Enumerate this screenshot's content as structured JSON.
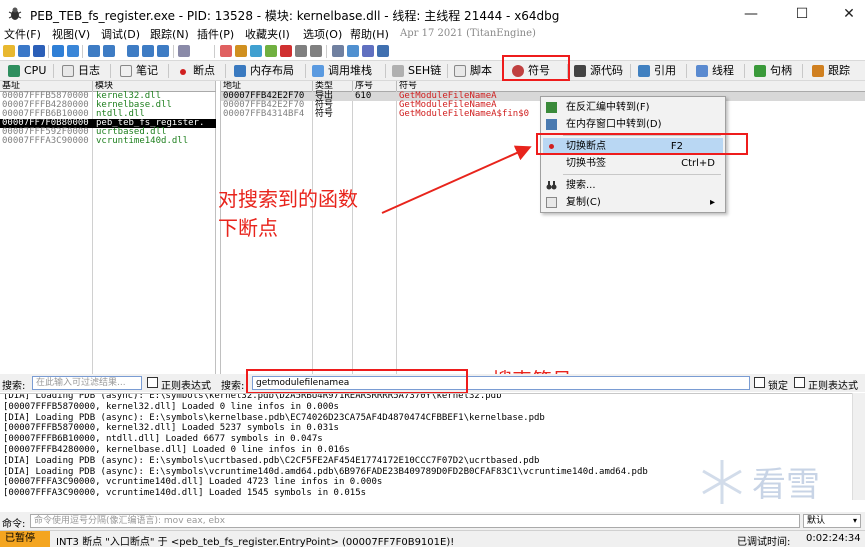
{
  "window": {
    "title": "PEB_TEB_fs_register.exe - PID: 13528 - 模块: kernelbase.dll - 线程: 主线程 21444 - x64dbg",
    "minimize": "—",
    "maximize": "☐",
    "close": "✕"
  },
  "menu": {
    "items": [
      "文件(F)",
      "视图(V)",
      "调试(D)",
      "跟踪(N)",
      "插件(P)",
      "收藏夹(I)",
      "选项(O)",
      "帮助(H)"
    ],
    "build_date": "Apr 17 2021 (TitanEngine)"
  },
  "tabs": [
    {
      "label": "CPU"
    },
    {
      "label": "日志"
    },
    {
      "label": "笔记"
    },
    {
      "label": "断点"
    },
    {
      "label": "内存布局"
    },
    {
      "label": "调用堆栈"
    },
    {
      "label": "SEH链"
    },
    {
      "label": "脚本"
    },
    {
      "label": "符号"
    },
    {
      "label": "源代码"
    },
    {
      "label": "引用"
    },
    {
      "label": "线程"
    },
    {
      "label": "句柄"
    },
    {
      "label": "跟踪"
    }
  ],
  "modules": {
    "headers": [
      "基址",
      "模块"
    ],
    "rows": [
      {
        "base": "00007FFFB5870000",
        "name": "kernel32.dll",
        "selected": false
      },
      {
        "base": "00007FFFB4280000",
        "name": "kernelbase.dll",
        "selected": false
      },
      {
        "base": "00007FFFB6B10000",
        "name": "ntdll.dll",
        "selected": false
      },
      {
        "base": "00007FF7F0B80000",
        "name": "peb_teb_fs_register.",
        "selected": true
      },
      {
        "base": "00007FFF592F0000",
        "name": "ucrtbased.dll",
        "selected": false
      },
      {
        "base": "00007FFFA3C90000",
        "name": "vcruntime140d.dll",
        "selected": false
      }
    ]
  },
  "symbols": {
    "headers": [
      "地址",
      "类型",
      "序号",
      "符号"
    ],
    "rows": [
      {
        "address": "00007FFB42E2F70",
        "type": "导出",
        "ordinal": "610",
        "symbol": "GetModuleFileNameA"
      },
      {
        "address": "00007FFB42E2F70",
        "type": "符号",
        "ordinal": "",
        "symbol": "GetModuleFileNameA"
      },
      {
        "address": "00007FFB4314BF4",
        "type": "符号",
        "ordinal": "",
        "symbol": "GetModuleFileNameA$fin$0"
      }
    ]
  },
  "context_menu": {
    "items": [
      {
        "label": "在反汇编中转到(F)",
        "key": ""
      },
      {
        "label": "在内存窗口中转到(D)",
        "key": ""
      },
      {
        "label": "切换断点",
        "key": "F2"
      },
      {
        "label": "切换书签",
        "key": "Ctrl+D"
      },
      {
        "label": "搜索...",
        "key": ""
      },
      {
        "label": "复制(C)",
        "key": "▸"
      }
    ]
  },
  "annotations": {
    "breakpoint_line1": "对搜索到的函数",
    "breakpoint_line2": "下断点",
    "search": "搜索符号"
  },
  "searchbar": {
    "left_label": "搜索:",
    "left_placeholder": "在此输入可过滤结果...",
    "regex_label": "正则表达式",
    "right_label": "搜索:",
    "right_value": "getmodulefilenamea",
    "lock_label": "锁定",
    "regex2_label": "正则表达式"
  },
  "log": {
    "lines": [
      "[DIA] Loading PDB (async): E:\\symbols\\kernel32.pdb\\D2A5RBU4R971REARSRRRR5A7370Y\\kernel32.pdb",
      "[00007FFFB5870000, kernel32.dll] Loaded 0 line infos in 0.000s",
      "[DIA] Loading PDB (async): E:\\symbols\\kernelbase.pdb\\EC74026D23CA75AF4D4870474CFBBEF1\\kernelbase.pdb",
      "[00007FFFB5870000, kernel32.dll] Loaded 5237 symbols in 0.031s",
      "[00007FFFB6B10000, ntdll.dll] Loaded 6677 symbols in 0.047s",
      "[00007FFFB4280000, kernelbase.dll] Loaded 0 line infos in 0.016s",
      "[DIA] Loading PDB (async): E:\\symbols\\ucrtbased.pdb\\C2CF5FE2AF454E1774172E10CCC7F07D2\\ucrtbased.pdb",
      "[DIA] Loading PDB (async): E:\\symbols\\vcruntime140d.amd64.pdb\\6B976FADE23B409789D0FD2B0CFAF83C1\\vcruntime140d.amd64.pdb",
      "[00007FFFA3C90000, vcruntime140d.dll] Loaded 4723 line infos in 0.000s",
      "[00007FFFA3C90000, vcruntime140d.dll] Loaded 1545 symbols in 0.015s"
    ]
  },
  "command": {
    "label": "命令:",
    "placeholder": "命令使用逗号分隔(像汇编语言): mov eax, ebx",
    "dropdown": "默认"
  },
  "status": {
    "state": "已暂停",
    "message": "INT3 断点 \"入口断点\" 于 <peb_teb_fs_register.EntryPoint> (00007FF7F0B9101E)!",
    "timer_label": "已调试时间:",
    "timer": "0:02:24:34"
  },
  "watermark": {
    "text": "看雪"
  },
  "colors": {
    "annotation_red": "#e8241c",
    "status_paused": "#f4a520",
    "selected_row": "#000000",
    "symbol_text": "#d02020",
    "module_text": "#208020"
  }
}
